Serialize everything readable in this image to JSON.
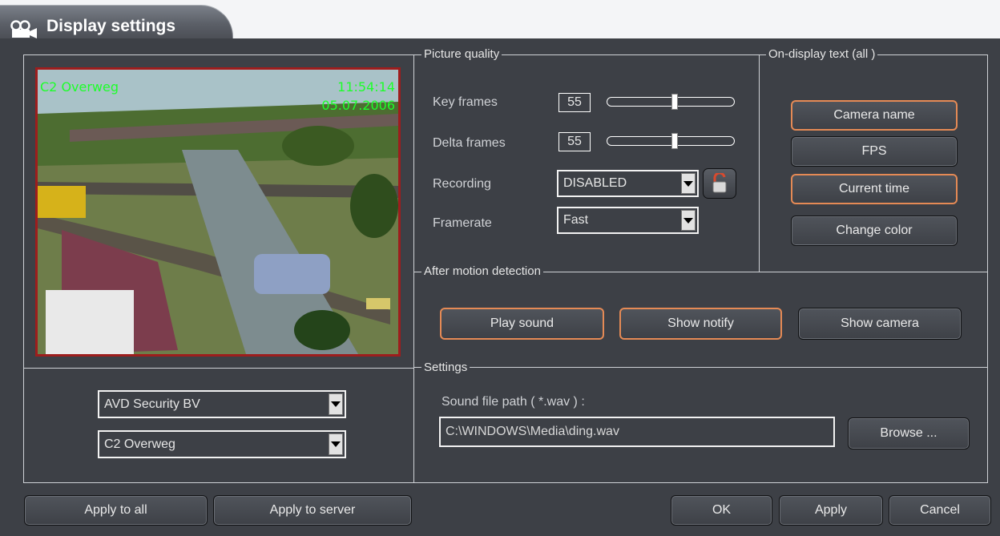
{
  "window": {
    "title": "Display settings"
  },
  "preview": {
    "camera_osd": "C2 Overweg",
    "time_osd": "11:54:14",
    "date_osd": "05.07.2006"
  },
  "selectors": {
    "site": "AVD Security BV",
    "camera": "C2 Overweg"
  },
  "picture_quality": {
    "legend": "Picture quality",
    "key_frames_label": "Key frames",
    "key_frames_value": "55",
    "delta_frames_label": "Delta frames",
    "delta_frames_value": "55",
    "recording_label": "Recording",
    "recording_value": "DISABLED",
    "framerate_label": "Framerate",
    "framerate_value": "Fast"
  },
  "on_display_text": {
    "legend": "On-display text (all )",
    "camera_name": "Camera name",
    "fps": "FPS",
    "current_time": "Current time",
    "change_color": "Change color"
  },
  "after_motion": {
    "legend": "After motion detection",
    "play_sound": "Play sound",
    "show_notify": "Show notify",
    "show_camera": "Show camera"
  },
  "settings": {
    "legend": "Settings",
    "sound_path_label": "Sound file path ( *.wav ) :",
    "sound_path_value": "C:\\WINDOWS\\Media\\ding.wav",
    "browse": "Browse ..."
  },
  "footer": {
    "apply_all": "Apply to all",
    "apply_server": "Apply to server",
    "ok": "OK",
    "apply": "Apply",
    "cancel": "Cancel"
  },
  "colors": {
    "background": "#3d4046",
    "osd_text": "#1dff2a",
    "active_border": "#e58a55",
    "preview_border": "#9e1d1d"
  }
}
